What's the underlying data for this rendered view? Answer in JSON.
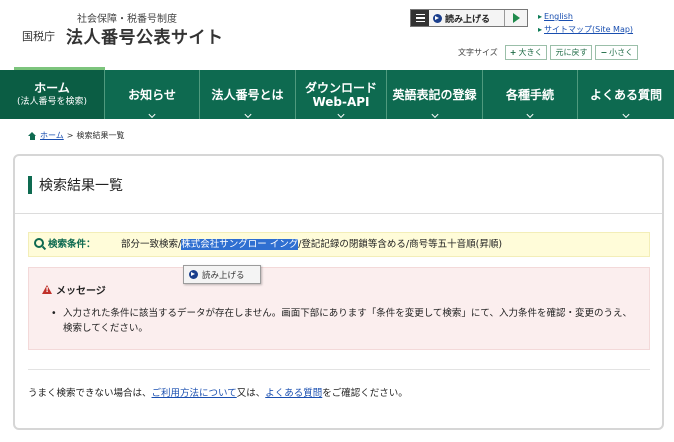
{
  "header": {
    "subtitle": "社会保障・税番号制度",
    "agency": "国税庁",
    "title": "法人番号公表サイト",
    "readbar_label": "読み上げる",
    "links": {
      "english": "English",
      "sitemap": "サイトマップ(Site Map)"
    },
    "font_size": {
      "label": "文字サイズ",
      "larger": "大きく",
      "reset": "元に戻す",
      "smaller": "小さく"
    }
  },
  "nav": {
    "items": [
      {
        "label": "ホーム",
        "sub": "(法人番号を検索)"
      },
      {
        "label": "お知らせ"
      },
      {
        "label": "法人番号とは"
      },
      {
        "label": "ダウンロード",
        "sub": "Web-API"
      },
      {
        "label": "英語表記の登録"
      },
      {
        "label": "各種手続"
      },
      {
        "label": "よくある質問"
      }
    ]
  },
  "breadcrumb": {
    "home": "ホーム",
    "separator": ">",
    "current": "検索結果一覧"
  },
  "main": {
    "title": "検索結果一覧",
    "condition": {
      "label": "検索条件：",
      "prefix": "部分一致検索/",
      "highlighted": "株式会社サングロー イング",
      "suffix": "/登記記録の閉鎖等含める/商号等五十音順(昇順)"
    },
    "tooltip_label": "読み上げる",
    "message": {
      "title": "メッセージ",
      "body": "入力された条件に該当するデータが存在しません。画面下部にあります「条件を変更して検索」にて、入力条件を確認・変更のうえ、検索してください。"
    },
    "help": {
      "prefix": "うまく検索できない場合は、",
      "link1": "ご利用方法について",
      "middle": "又は、",
      "link2": "よくある質問",
      "suffix": "をご確認ください。"
    }
  },
  "colors": {
    "brand_green": "#0e6a50",
    "link_blue": "#1a4fb0",
    "highlight_blue": "#2f6fd1",
    "warning_red": "#c0302a"
  }
}
